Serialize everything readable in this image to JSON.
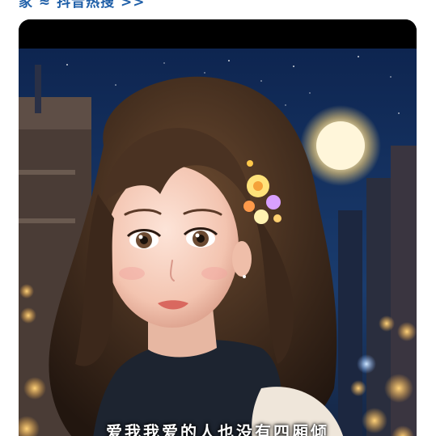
{
  "header": {
    "link_text": "家  ≈ 抖音热搜  >>"
  },
  "video": {
    "subtitle": "爱我我爱的人也没有四厢倾"
  },
  "colors": {
    "link": "#1f5fa8",
    "sky_top": "#0f2a52",
    "moon": "#fff2c8"
  }
}
